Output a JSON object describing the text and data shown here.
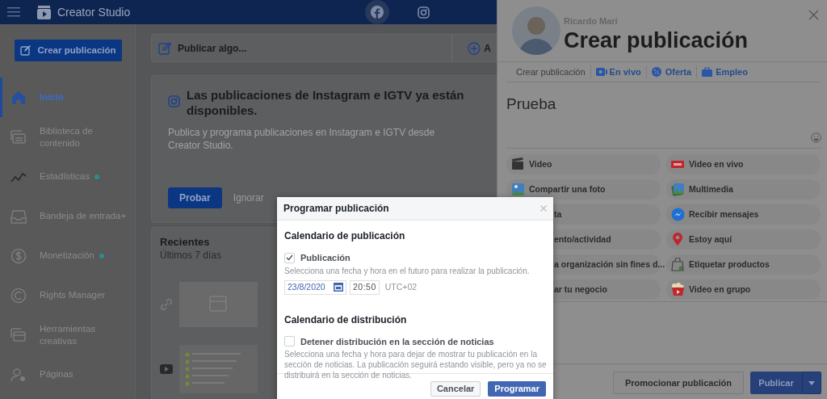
{
  "top_bar": {
    "app_name": "Creator Studio"
  },
  "sidebar": {
    "create_button": "Crear publicación",
    "items": [
      {
        "label": "Inicio",
        "selected": true,
        "dot": false
      },
      {
        "label": "Biblioteca de contenido",
        "selected": false,
        "dot": false
      },
      {
        "label": "Estadísticas",
        "selected": false,
        "dot": true
      },
      {
        "label": "Bandeja de entrada+",
        "selected": false,
        "dot": false
      },
      {
        "label": "Monetización",
        "selected": false,
        "dot": true
      },
      {
        "label": "Rights Manager",
        "selected": false,
        "dot": false
      },
      {
        "label": "Herramientas creativas",
        "selected": false,
        "dot": false
      },
      {
        "label": "Páginas",
        "selected": false,
        "dot": false
      }
    ]
  },
  "main": {
    "composer": {
      "label": "Publicar algo...",
      "second_label": "A"
    },
    "notice": {
      "title": "Las publicaciones de Instagram e IGTV ya están disponibles.",
      "text": "Publica y programa publicaciones en Instagram e IGTV desde Creator Studio.",
      "primary": "Probar",
      "secondary": "Ignorar"
    },
    "recent": {
      "title": "Recientes",
      "subtitle": "Últimos 7 días"
    }
  },
  "panel": {
    "author": "Ricardo Marí",
    "title": "Crear publicación",
    "tabs": [
      {
        "label": "Crear publicación",
        "selected": true
      },
      {
        "label": "En vivo",
        "selected": false
      },
      {
        "label": "Oferta",
        "selected": false
      },
      {
        "label": "Empleo",
        "selected": false
      }
    ],
    "text": "Prueba",
    "options": [
      {
        "label": "Video",
        "kind": "full"
      },
      {
        "label": "Video en vivo",
        "kind": "full"
      },
      {
        "label": "Compartir una foto",
        "kind": "full"
      },
      {
        "label": "Multimedia",
        "kind": "full"
      },
      {
        "label": "ta",
        "kind": "covered"
      },
      {
        "label": "Recibir mensajes",
        "kind": "full"
      },
      {
        "label": "ento/actividad",
        "kind": "covered"
      },
      {
        "label": "Estoy aquí",
        "kind": "full"
      },
      {
        "label": "a organización sin fines d...",
        "kind": "covered"
      },
      {
        "label": "Etiquetar productos",
        "kind": "full"
      },
      {
        "label": "ar tu negocio",
        "kind": "covered"
      },
      {
        "label": "Video en grupo",
        "kind": "full"
      }
    ],
    "promote": "Promocionar publicación",
    "publish": "Publicar"
  },
  "modal": {
    "title": "Programar publicación",
    "sections": [
      {
        "heading": "Calendario de publicación",
        "checkbox": {
          "label": "Publicación",
          "checked": true
        },
        "hint": "Selecciona una fecha y hora en el futuro para realizar la publicación.",
        "date": "23/8/2020",
        "time": "20:50",
        "timezone": "UTC+02"
      },
      {
        "heading": "Calendario de distribución",
        "checkbox": {
          "label": "Detener distribución en la sección de noticias",
          "checked": false
        },
        "hint": "Selecciona una fecha y hora para dejar de mostrar tu publicación en la sección de noticias. La publicación seguirá estando visible, pero ya no se distribuirá en la sección de noticias."
      }
    ],
    "cancel": "Cancelar",
    "confirm": "Programar"
  }
}
